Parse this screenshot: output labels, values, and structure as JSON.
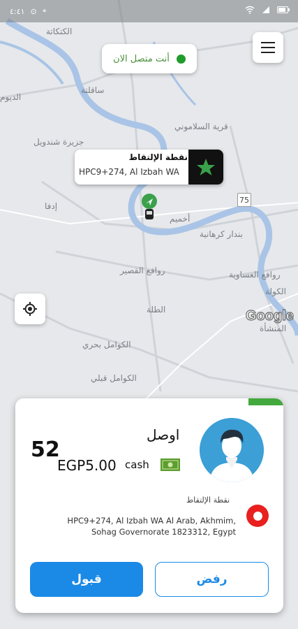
{
  "status_bar": {
    "time": "٤:٤١"
  },
  "map": {
    "labels": [
      "الكتكاتة",
      "ساقلتة",
      "قرية السلاموني",
      "جزيرة شندويل",
      "إدفا",
      "أخميم",
      "بندار كرهانية",
      "روافع القصير",
      "روافع العساوية",
      "الكولة",
      "المنشأة",
      "الطلة",
      "الكوامل بحري",
      "الكوامل قبلي",
      "الديوم"
    ],
    "route_badge": "75",
    "google_logo": "Google"
  },
  "online_status": {
    "label": "أنت متصل الان",
    "color": "#1f9d2a"
  },
  "pickup_marker": {
    "title": "نقطة الإلتقاط",
    "address_short": "HPC9+274, Al Izbah WA"
  },
  "request": {
    "eta_minutes": "52",
    "arrive_label": "اوصل",
    "price": "EGP5.00",
    "payment_type": "cash",
    "pickup_label": "نقطة الإلتقاط",
    "address": "HPC9+274, Al Izbah WA Al Arab, Akhmim, Sohag Governorate 1823312, Egypt",
    "accept_label": "قبول",
    "reject_label": "رفض"
  },
  "colors": {
    "accent": "#1b8ae6",
    "online_green": "#43a83d",
    "pickup_red": "#e8201f"
  },
  "icons": [
    "wifi-icon",
    "battery-icon",
    "menu-icon",
    "star-icon",
    "navigation-arrow-icon",
    "locate-icon",
    "cash-icon",
    "avatar-icon",
    "pin-icon"
  ]
}
